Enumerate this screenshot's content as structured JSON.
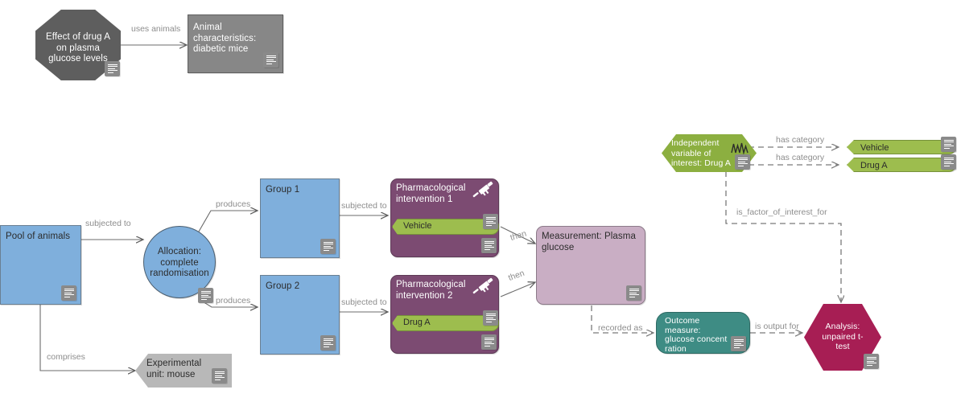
{
  "diagram": {
    "title": "Experimental design diagram: Effect of drug A on plasma glucose levels",
    "colors": {
      "blue": "#7FAFDC",
      "grey": "#878787",
      "dark_grey": "#5e5e5e",
      "purple": "#7C4B72",
      "mauve": "#C9AEC4",
      "green": "#8CAF40",
      "chip_green": "#9DBD4E",
      "teal": "#3E8C84",
      "crimson": "#A71E54",
      "edge": "#6b6b6b",
      "edge_label": "#8d8d8d"
    }
  },
  "nodes": {
    "study": {
      "label": "Effect of drug A\non plasma\nglucose levels",
      "shape": "octagon",
      "icon": "note-icon"
    },
    "animal_characteristics": {
      "label": "Animal\ncharacteristics:\ndiabetic mice",
      "shape": "rectangle",
      "icon": "note-icon"
    },
    "pool_of_animals": {
      "label": "Pool of animals",
      "shape": "rectangle",
      "icon": "note-icon"
    },
    "allocation": {
      "label": "Allocation:\ncomplete\nrandomisation",
      "shape": "circle",
      "icon": "note-icon"
    },
    "experimental_unit": {
      "label": "Experimental\nunit: mouse",
      "shape": "hexagon",
      "icon": "note-icon"
    },
    "group1": {
      "label": "Group 1",
      "shape": "rectangle",
      "icon": "note-icon"
    },
    "group2": {
      "label": "Group 2",
      "shape": "rectangle",
      "icon": "note-icon"
    },
    "intervention1": {
      "label": "Pharmacological\nintervention 1",
      "shape": "rounded-card",
      "icon": "syringe-icon",
      "chip": "Vehicle",
      "chip_icon": "note-icon",
      "icon2": "note-icon"
    },
    "intervention2": {
      "label": "Pharmacological\nintervention 2",
      "shape": "rounded-card",
      "icon": "syringe-icon",
      "chip": "Drug A",
      "chip_icon": "note-icon",
      "icon2": "note-icon"
    },
    "measurement": {
      "label": "Measurement: Plasma\nglucose",
      "shape": "rounded-card",
      "icon": "note-icon"
    },
    "independent_variable": {
      "label": "Independent\nvariable of\ninterest: Drug A",
      "shape": "hexagon",
      "icon": "waveform-icon",
      "icon2": "note-icon"
    },
    "category_vehicle": {
      "label": "Vehicle",
      "shape": "chevron-chip",
      "icon": "note-icon"
    },
    "category_drug_a": {
      "label": "Drug A",
      "shape": "chevron-chip",
      "icon": "note-icon"
    },
    "outcome_measure": {
      "label": "Outcome\nmeasure:\nglucose concent\nration",
      "shape": "pill",
      "icon": "note-icon"
    },
    "analysis": {
      "label": "Analysis:\nunpaired t-\ntest",
      "shape": "hexagon",
      "icon": "note-icon"
    }
  },
  "edges": {
    "uses_animals": "uses animals",
    "subjected_to_allocation": "subjected to",
    "comprises": "comprises",
    "produces_1": "produces",
    "produces_2": "produces",
    "subjected_to_1": "subjected to",
    "subjected_to_2": "subjected to",
    "then_1": "then",
    "then_2": "then",
    "recorded_as": "recorded as",
    "is_output_for": "is output for",
    "has_category_1": "has category",
    "has_category_2": "has category",
    "is_factor_of_interest_for": "is_factor_of_interest_for"
  }
}
